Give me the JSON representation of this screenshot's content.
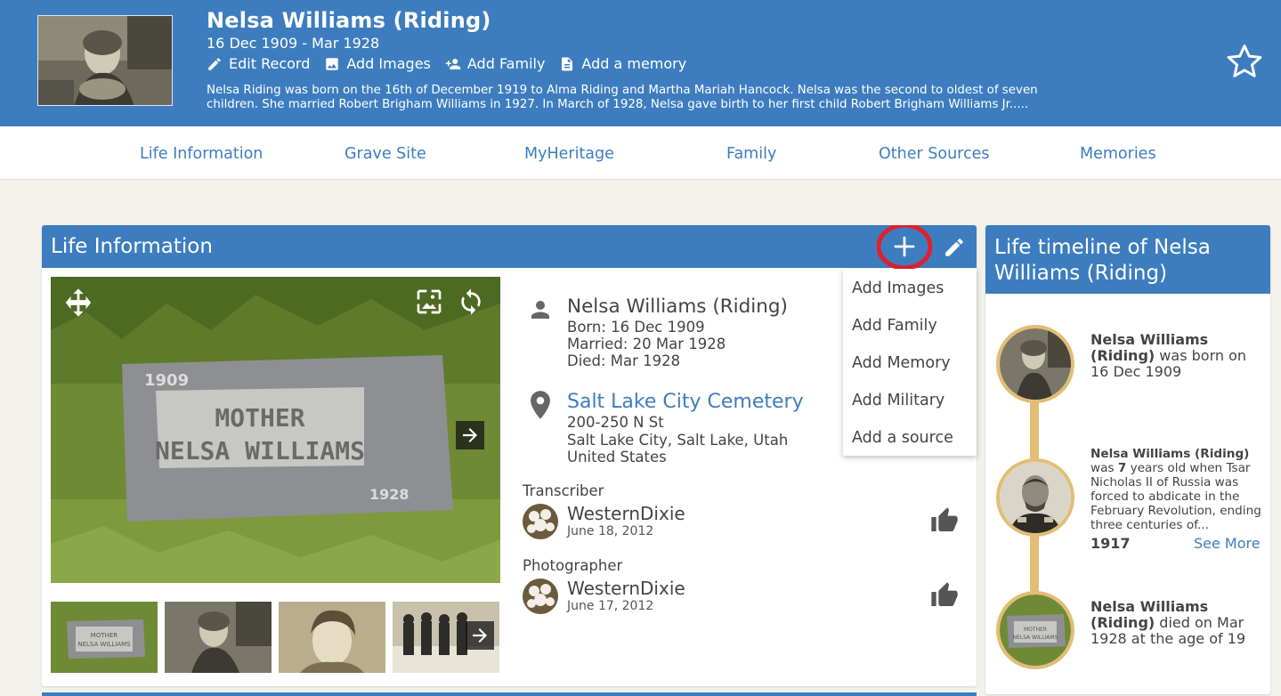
{
  "header": {
    "name": "Nelsa Williams (Riding)",
    "dates": "16 Dec 1909 - Mar 1928",
    "actions": [
      {
        "label": "Edit Record",
        "icon": "pencil-icon"
      },
      {
        "label": "Add Images",
        "icon": "image-icon"
      },
      {
        "label": "Add Family",
        "icon": "add-family-icon"
      },
      {
        "label": "Add a memory",
        "icon": "document-icon"
      }
    ],
    "bio_line1": "Nelsa Riding was born on the 16th of December 1919 to Alma Riding and Martha Mariah Hancock. Nelsa was the second to oldest of seven",
    "bio_line2": "children. She married Robert Brigham Williams in 1927. In March of 1928, Nelsa gave birth to her first child Robert Brigham Williams Jr.....",
    "favorite_icon": "star-outline-icon"
  },
  "nav": [
    "Life Information",
    "Grave Site",
    "MyHeritage",
    "Family",
    "Other Sources",
    "Memories"
  ],
  "life_info": {
    "title": "Life Information",
    "headstone": {
      "year_top": "1909",
      "line1": "MOTHER",
      "line2": "NELSA WILLIAMS",
      "year_bottom": "1928"
    },
    "thumb_headstone": {
      "line1": "MOTHER",
      "line2": "NELSA WILLIAMS"
    },
    "person": {
      "name": "Nelsa Williams (Riding)",
      "born": "Born: 16 Dec 1909",
      "married": "Married: 20 Mar 1928",
      "died": "Died: Mar 1928"
    },
    "place": {
      "cemetery": "Salt Lake City Cemetery",
      "street": "200-250 N St",
      "city": "Salt Lake City, Salt Lake, Utah",
      "country": "United States"
    },
    "transcriber": {
      "label": "Transcriber",
      "name": "WesternDixie",
      "date": "June 18, 2012"
    },
    "photographer": {
      "label": "Photographer",
      "name": "WesternDixie",
      "date": "June 17, 2012"
    }
  },
  "dropdown": [
    "Add Images",
    "Add Family",
    "Add Memory",
    "Add Military",
    "Add a source"
  ],
  "timeline": {
    "title": "Life timeline of Nelsa Williams (Riding)",
    "event1": {
      "name": "Nelsa Williams (Riding)",
      "text": " was born on 16 Dec 1909"
    },
    "event2": {
      "name": "Nelsa Williams (Riding)",
      "was": "was",
      "age": "7",
      "text": " years old when Tsar Nicholas II of Russia was forced to abdicate in the February Revolution, ending three centuries of...",
      "year": "1917",
      "see_more": "See More"
    },
    "event3": {
      "name": "Nelsa Williams (Riding)",
      "text": " died on Mar 1928 at the age of 19"
    }
  },
  "colors": {
    "brand_blue": "#3d7dbf",
    "timeline_gold": "#e3bd75",
    "highlight_red": "#e0202a"
  }
}
